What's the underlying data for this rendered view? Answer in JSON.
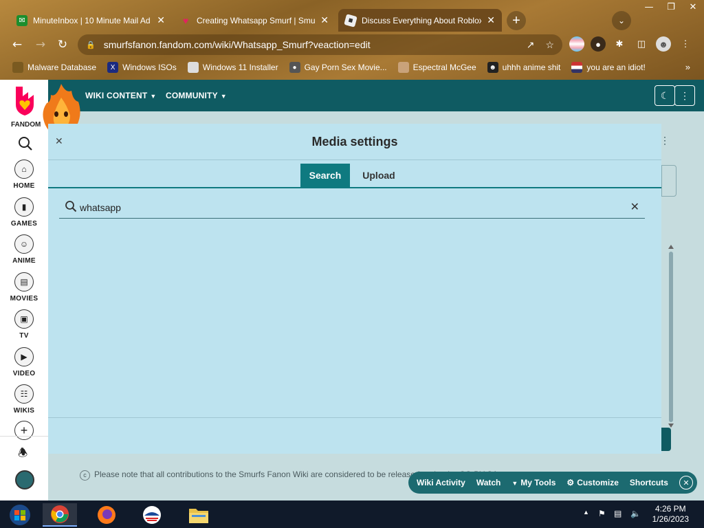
{
  "browser": {
    "tabs": [
      {
        "title": "MinuteInbox | 10 Minute Mail Ad",
        "favicon": "mail-icon"
      },
      {
        "title": "Creating Whatsapp Smurf | Smur",
        "favicon": "fandom-icon"
      },
      {
        "title": "Discuss Everything About Roblox",
        "favicon": "roblox-icon"
      }
    ],
    "url": "smurfsfanon.fandom.com/wiki/Whatsapp_Smurf?veaction=edit",
    "bookmarks": [
      {
        "label": "Malware Database"
      },
      {
        "label": "Windows ISOs"
      },
      {
        "label": "Windows 11 Installer"
      },
      {
        "label": "Gay Porn Sex Movie..."
      },
      {
        "label": "Espectral McGee"
      },
      {
        "label": "uhhh anime shit"
      },
      {
        "label": "you are an idiot!"
      }
    ]
  },
  "fandom": {
    "logo_text": "FANDOM",
    "nav": {
      "wiki_content": "WIKI CONTENT",
      "community": "COMMUNITY"
    },
    "rail": [
      {
        "label": "HOME"
      },
      {
        "label": "GAMES"
      },
      {
        "label": "ANIME"
      },
      {
        "label": "MOVIES"
      },
      {
        "label": "TV"
      },
      {
        "label": "VIDEO"
      },
      {
        "label": "WIKIS"
      }
    ],
    "notice": "Please note that all contributions to the Smurfs Fanon Wiki are considered to be released under the CC-BY-SA",
    "toolbar": {
      "wiki_activity": "Wiki Activity",
      "watch": "Watch",
      "my_tools": "My Tools",
      "customize": "Customize",
      "shortcuts": "Shortcuts"
    }
  },
  "modal": {
    "title": "Media settings",
    "tabs": {
      "search": "Search",
      "upload": "Upload"
    },
    "search_value": "whatsapp"
  },
  "taskbar": {
    "time": "4:26 PM",
    "date": "1/26/2023"
  },
  "colors": {
    "fandom_teal": "#0f5b62",
    "modal_bg": "#bde3ef",
    "tab_active": "#0f7a80"
  }
}
